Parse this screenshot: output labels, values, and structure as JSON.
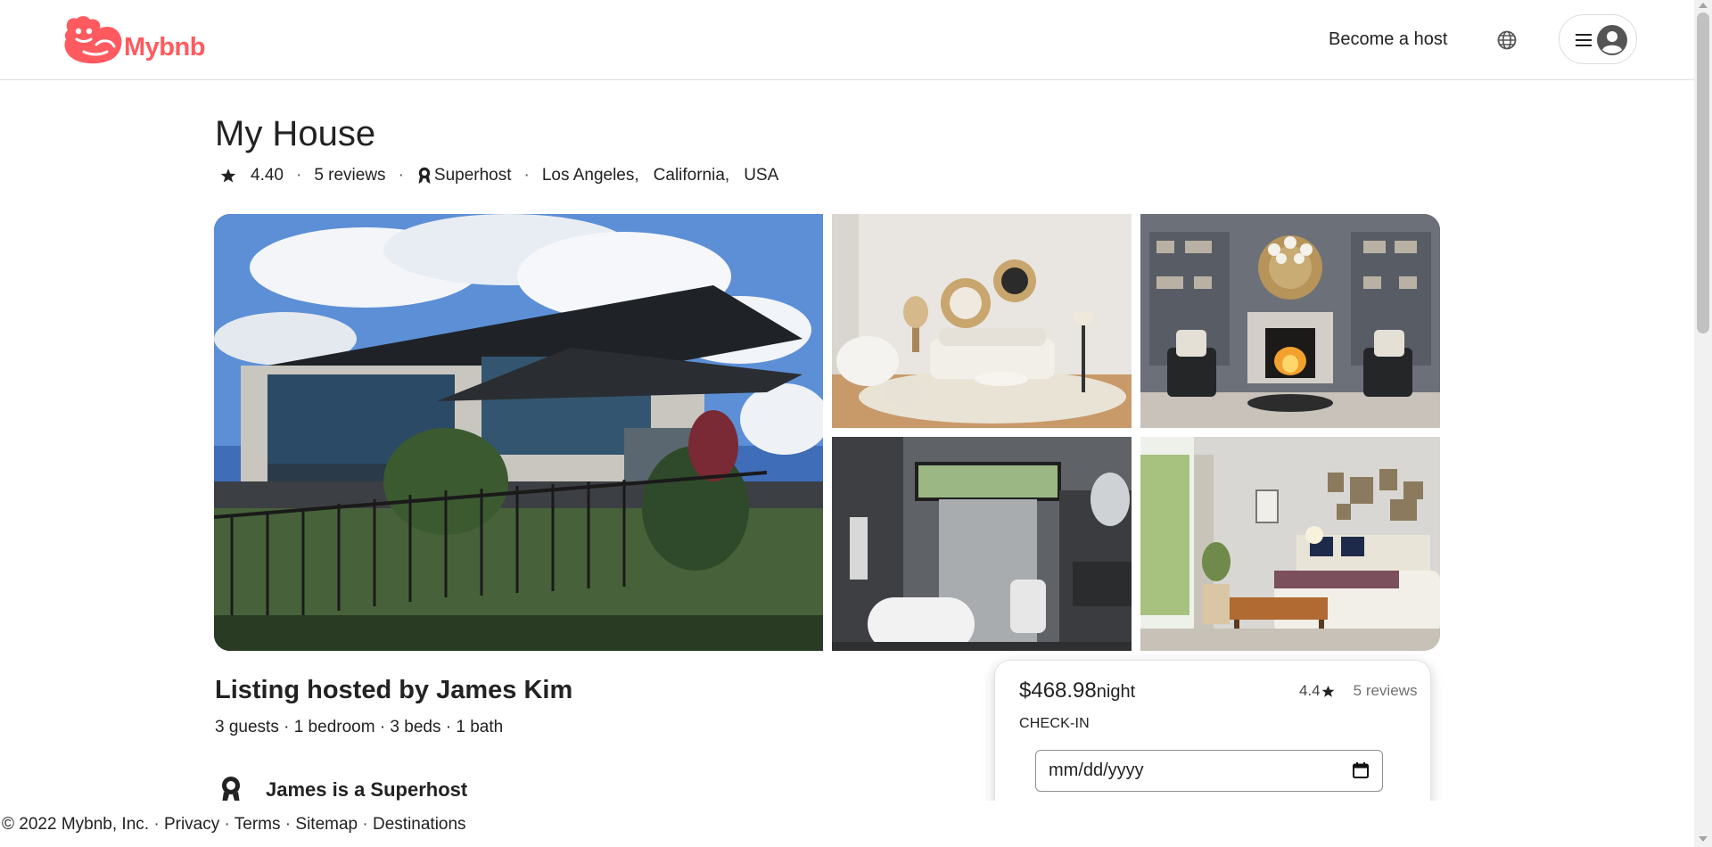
{
  "header": {
    "logo_text": "Mybnb",
    "become_host": "Become a host"
  },
  "listing": {
    "title": "My House",
    "rating": "4.40",
    "reviews": "5 reviews",
    "superhost": "Superhost",
    "city": "Los Angeles,",
    "state": "California,",
    "country": "USA",
    "meta_separator": "·"
  },
  "photos": {
    "main_alt": "Modern house exterior",
    "photo1_alt": "Living room",
    "photo2_alt": "Fireplace lounge",
    "photo3_alt": "Bathroom",
    "photo4_alt": "Bedroom"
  },
  "host_section": {
    "hosted_by": "Listing hosted by James Kim",
    "specs": "3 guests · 1 bedroom · 3 beds · 1 bath",
    "superhost_line": "James is a Superhost"
  },
  "booking": {
    "price": "$468.98",
    "price_unit": "night",
    "rating": "4.4",
    "reviews": "5 reviews",
    "checkin_label": "CHECK-IN",
    "date_placeholder": "mm/dd/yyyy"
  },
  "footer": {
    "copyright": "© 2022 Mybnb, Inc.",
    "links": [
      "Privacy",
      "Terms",
      "Sitemap",
      "Destinations"
    ],
    "separator": "·"
  },
  "colors": {
    "brand": "#ff5a5f",
    "text": "#222222",
    "muted": "#717171",
    "border": "#dcdcdc"
  },
  "icons": [
    "logo-mark-icon",
    "globe-icon",
    "hamburger-icon",
    "user-avatar-icon",
    "star-icon",
    "superhost-medal-icon",
    "calendar-icon"
  ]
}
